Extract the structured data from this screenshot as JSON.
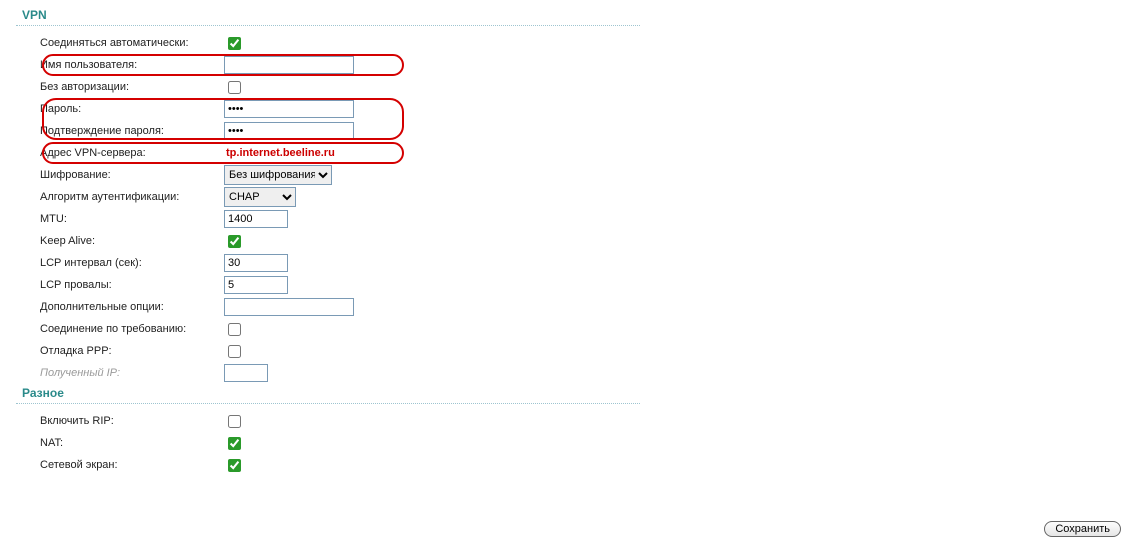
{
  "sections": {
    "vpn": {
      "title": "VPN"
    },
    "misc": {
      "title": "Разное"
    }
  },
  "fields": {
    "auto_connect": {
      "label": "Соединяться автоматически:"
    },
    "username": {
      "label": "Имя пользователя:",
      "value": ""
    },
    "no_auth": {
      "label": "Без авторизации:"
    },
    "password": {
      "label": "Пароль:",
      "value": "••••"
    },
    "password2": {
      "label": "Подтверждение пароля:",
      "value": "••••"
    },
    "vpn_server": {
      "label": "Адрес VPN-сервера:",
      "value": "tp.internet.beeline.ru"
    },
    "encryption": {
      "label": "Шифрование:",
      "value": "Без шифрования"
    },
    "auth_algo": {
      "label": "Алгоритм аутентификации:",
      "value": "CHAP"
    },
    "mtu": {
      "label": "MTU:",
      "value": "1400"
    },
    "keep_alive": {
      "label": "Keep Alive:"
    },
    "lcp_interval": {
      "label": "LCP интервал (сек):",
      "value": "30"
    },
    "lcp_fails": {
      "label": "LCP провалы:",
      "value": "5"
    },
    "extra_opts": {
      "label": "Дополнительные опции:",
      "value": ""
    },
    "on_demand": {
      "label": "Соединение по требованию:"
    },
    "ppp_debug": {
      "label": "Отладка PPP:"
    },
    "received_ip": {
      "label": "Полученный IP:",
      "value": ""
    },
    "enable_rip": {
      "label": "Включить RIP:"
    },
    "nat": {
      "label": "NAT:"
    },
    "firewall": {
      "label": "Сетевой экран:"
    }
  },
  "buttons": {
    "save": "Сохранить"
  }
}
